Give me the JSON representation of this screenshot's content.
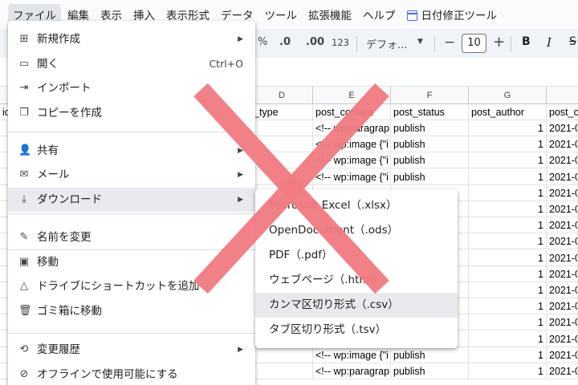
{
  "menubar": {
    "items": [
      "ファイル",
      "編集",
      "表示",
      "挿入",
      "表示形式",
      "データ",
      "ツール",
      "拡張機能",
      "ヘルプ"
    ],
    "addon": "日付修正ツール"
  },
  "toolbar": {
    "percent": "%",
    "dec_decrease": ".0",
    "dec_increase": ".00",
    "number_format": "123",
    "font": "デフォ...",
    "minus": "−",
    "font_size": "10",
    "plus": "+",
    "bold": "B",
    "italic": "I",
    "strike": "S"
  },
  "grid": {
    "column_letters": [
      "D",
      "E",
      "F",
      "G",
      ""
    ],
    "header_partial_left": "ic",
    "headers": [
      "_type",
      "post_content",
      "post_status",
      "post_author",
      "post_c"
    ],
    "rows": [
      {
        "content": "<!-- wp:paragrap",
        "status": "publish",
        "author": "1",
        "date": "2021-0"
      },
      {
        "content": "<!-- wp:image {\"i",
        "status": "publish",
        "author": "1",
        "date": "2021-0"
      },
      {
        "content": "<!-- wp:image {\"i",
        "status": "publish",
        "author": "1",
        "date": "2021-0"
      },
      {
        "content": "<!-- wp:image {\"i",
        "status": "publish",
        "author": "1",
        "date": "2021-0"
      },
      {
        "content": "",
        "status": "",
        "author": "1",
        "date": "2021-0"
      },
      {
        "content": "",
        "status": "",
        "author": "1",
        "date": "2021-0"
      },
      {
        "content": "",
        "status": "",
        "author": "1",
        "date": "2021-0"
      },
      {
        "content": "",
        "status": "",
        "author": "1",
        "date": "2021-0"
      },
      {
        "content": "",
        "status": "",
        "author": "1",
        "date": "2021-0"
      },
      {
        "content": "",
        "status": "",
        "author": "1",
        "date": "2021-0"
      },
      {
        "content": "",
        "status": "",
        "author": "1",
        "date": "2021-0"
      },
      {
        "content": "",
        "status": "",
        "author": "1",
        "date": "2021-0"
      },
      {
        "content": "",
        "status": "",
        "author": "1",
        "date": "2021-0"
      },
      {
        "content": "",
        "status": "",
        "author": "1",
        "date": "2021-0"
      },
      {
        "content": "<!-- wp:image {\"i",
        "status": "publish",
        "author": "1",
        "date": "2021-0"
      },
      {
        "content": "<!-- wp:paragrap",
        "status": "publish",
        "author": "1",
        "date": "2021-0"
      }
    ]
  },
  "file_menu": {
    "items": [
      {
        "icon": "plus-square-icon",
        "glyph": "⊞",
        "label": "新規作成",
        "shortcut": "",
        "submenu": true
      },
      {
        "icon": "folder-icon",
        "glyph": "▭",
        "label": "開く",
        "shortcut": "Ctrl+O",
        "submenu": false
      },
      {
        "icon": "import-icon",
        "glyph": "⇥",
        "label": "インポート",
        "shortcut": "",
        "submenu": false
      },
      {
        "icon": "copy-icon",
        "glyph": "❐",
        "label": "コピーを作成",
        "shortcut": "",
        "submenu": false
      },
      {
        "icon": "share-icon",
        "glyph": "👤",
        "label": "共有",
        "shortcut": "",
        "submenu": true
      },
      {
        "icon": "mail-icon",
        "glyph": "✉",
        "label": "メール",
        "shortcut": "",
        "submenu": true
      },
      {
        "icon": "download-icon",
        "glyph": "⤓",
        "label": "ダウンロード",
        "shortcut": "",
        "submenu": true
      },
      {
        "icon": "pencil-icon",
        "glyph": "✎",
        "label": "名前を変更",
        "shortcut": "",
        "submenu": false
      },
      {
        "icon": "move-folder-icon",
        "glyph": "▣",
        "label": "移動",
        "shortcut": "",
        "submenu": false
      },
      {
        "icon": "drive-shortcut-icon",
        "glyph": "△",
        "label": "ドライブにショートカットを追加",
        "shortcut": "",
        "submenu": false
      },
      {
        "icon": "trash-icon",
        "glyph": "🗑",
        "label": "ゴミ箱に移動",
        "shortcut": "",
        "submenu": false
      },
      {
        "icon": "history-icon",
        "glyph": "⟲",
        "label": "変更履歴",
        "shortcut": "",
        "submenu": true
      },
      {
        "icon": "offline-icon",
        "glyph": "⊘",
        "label": "オフラインで使用可能にする",
        "shortcut": "",
        "submenu": false
      }
    ],
    "submenu_arrow": "▶"
  },
  "download_submenu": {
    "items": [
      "Microsoft Excel（.xlsx）",
      "OpenDocument（.ods）",
      "PDF（.pdf）",
      "ウェブページ（.html）",
      "カンマ区切り形式（.csv）",
      "タブ区切り形式（.tsv）"
    ],
    "highlighted_index": 4
  },
  "overlay": {
    "x_mark_color": "#f07a7f"
  }
}
